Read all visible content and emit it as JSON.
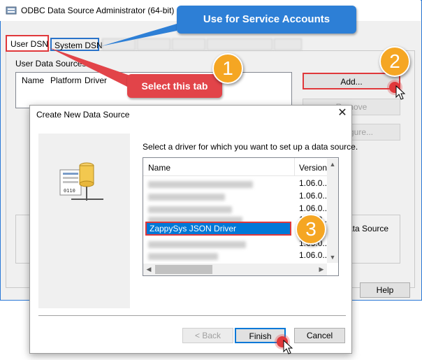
{
  "window": {
    "title": "ODBC Data Source Administrator (64-bit)",
    "tabs": [
      "User DSN",
      "System DSN"
    ],
    "user_data_sources_label": "User Data Sources:",
    "columns": [
      "Name",
      "Platform",
      "Driver"
    ],
    "buttons": {
      "add": "Add...",
      "remove": "Remove",
      "configure": "Configure...",
      "help": "Help"
    },
    "info_text": "ata Source"
  },
  "callouts": {
    "service_accounts": "Use for Service Accounts",
    "select_tab": "Select this tab",
    "step1": "1",
    "step2": "2",
    "step3": "3"
  },
  "dialog": {
    "title": "Create New Data Source",
    "close_glyph": "✕",
    "prompt": "Select a driver for which you want to set up a data source.",
    "columns": [
      "Name",
      "Version"
    ],
    "rows": [
      {
        "name": "",
        "version": "1.06.0..."
      },
      {
        "name": "",
        "version": "1.06.0..."
      },
      {
        "name": "",
        "version": "1.06.0..."
      },
      {
        "name": "",
        "version": "1.06.0..."
      },
      {
        "name": "ZappySys JSON Driver",
        "version": "1.06.0..."
      },
      {
        "name": "",
        "version": "1.06.0..."
      },
      {
        "name": "",
        "version": "1.06.0..."
      }
    ],
    "buttons": {
      "back": "< Back",
      "finish": "Finish",
      "cancel": "Cancel"
    }
  },
  "colors": {
    "accent_blue": "#2d7fd6",
    "highlight_red": "#e0383b",
    "badge_orange": "#f5a623",
    "selection": "#0078d7"
  }
}
